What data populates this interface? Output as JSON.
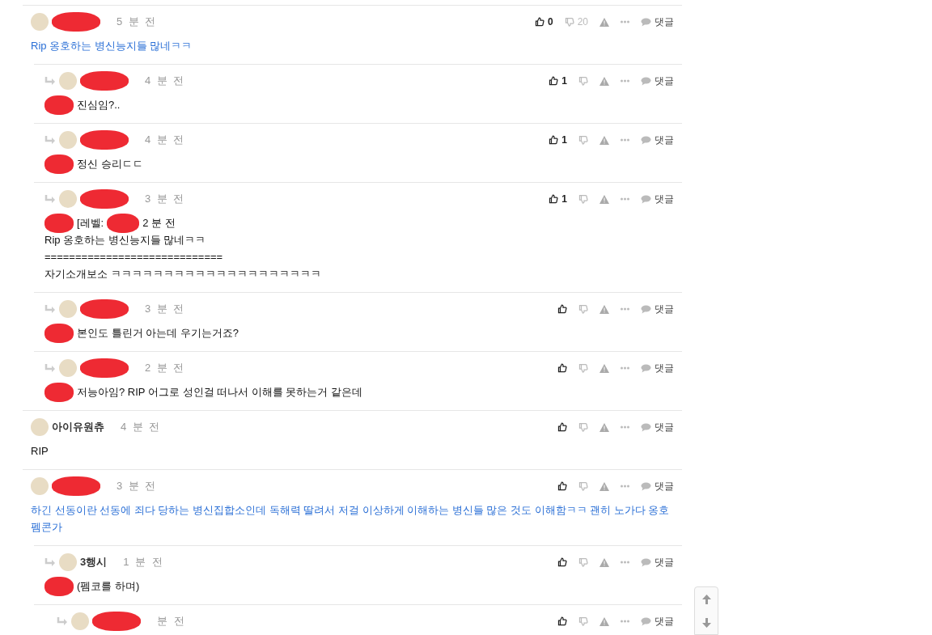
{
  "comments": [
    {
      "author_redacted": true,
      "time": "5 분 전",
      "highlighted": true,
      "body_redacted": false,
      "body_lines": [
        "Rip 옹호하는 병신능지들 많네ㅋㅋ"
      ],
      "up_count": "0",
      "down_count": "20",
      "reply_label": "댓글",
      "children": [
        {
          "author_redacted": true,
          "time": "4 분 전",
          "highlighted": false,
          "body_redacted": true,
          "body_lines": [
            "진심임?.."
          ],
          "up_count": "1",
          "reply_label": "댓글"
        },
        {
          "author_redacted": true,
          "time": "4 분 전",
          "highlighted": false,
          "body_redacted": true,
          "body_lines": [
            "정신 승리ㄷㄷ"
          ],
          "up_count": "1",
          "reply_label": "댓글"
        },
        {
          "author_redacted": true,
          "time": "3 분 전",
          "highlighted": false,
          "body_redacted": true,
          "quote_header": [
            "[레벨:",
            "2 분 전"
          ],
          "body_lines": [
            "Rip 옹호하는 병신능지들 많네ㅋㅋ",
            "=============================",
            "자기소개보소 ㅋㅋㅋㅋㅋㅋㅋㅋㅋㅋㅋㅋㅋㅋㅋㅋㅋㅋㅋㅋ"
          ],
          "up_count": "1",
          "reply_label": "댓글"
        },
        {
          "author_redacted": true,
          "time": "3 분 전",
          "highlighted": false,
          "body_redacted": true,
          "body_lines": [
            "본인도 틀린거 아는데 우기는거죠?"
          ],
          "reply_label": "댓글"
        },
        {
          "author_redacted": true,
          "time": "2 분 전",
          "highlighted": false,
          "body_redacted": true,
          "body_lines": [
            "저능아임? RIP 어그로 성인걸 떠나서 이해를 못하는거 같은데"
          ],
          "reply_label": "댓글"
        }
      ]
    },
    {
      "author": "아이유원츄",
      "author_redacted": false,
      "time": "4 분 전",
      "highlighted": false,
      "body_redacted": false,
      "body_lines": [
        "RIP"
      ],
      "reply_label": "댓글"
    },
    {
      "author_redacted": true,
      "time": "3 분 전",
      "highlighted": true,
      "body_redacted": false,
      "body_lines": [
        "하긴 선동이란 선동에 죄다 당하는 병신집합소인데 독해력 딸려서 저걸 이상하게 이해하는 병신들 많은 것도 이해함ㅋㅋ 괜히 노가다 옹호 펨콘가"
      ],
      "reply_label": "댓글",
      "children": [
        {
          "author": "3행시",
          "author_redacted": false,
          "time": "1 분 전",
          "highlighted": false,
          "body_redacted": true,
          "body_lines": [
            "(펨코를 하며)"
          ],
          "reply_label": "댓글",
          "children": [
            {
              "author_redacted": true,
              "time": "분 전",
              "body_redacted": false,
              "reply_label": "댓글"
            }
          ]
        }
      ]
    }
  ]
}
